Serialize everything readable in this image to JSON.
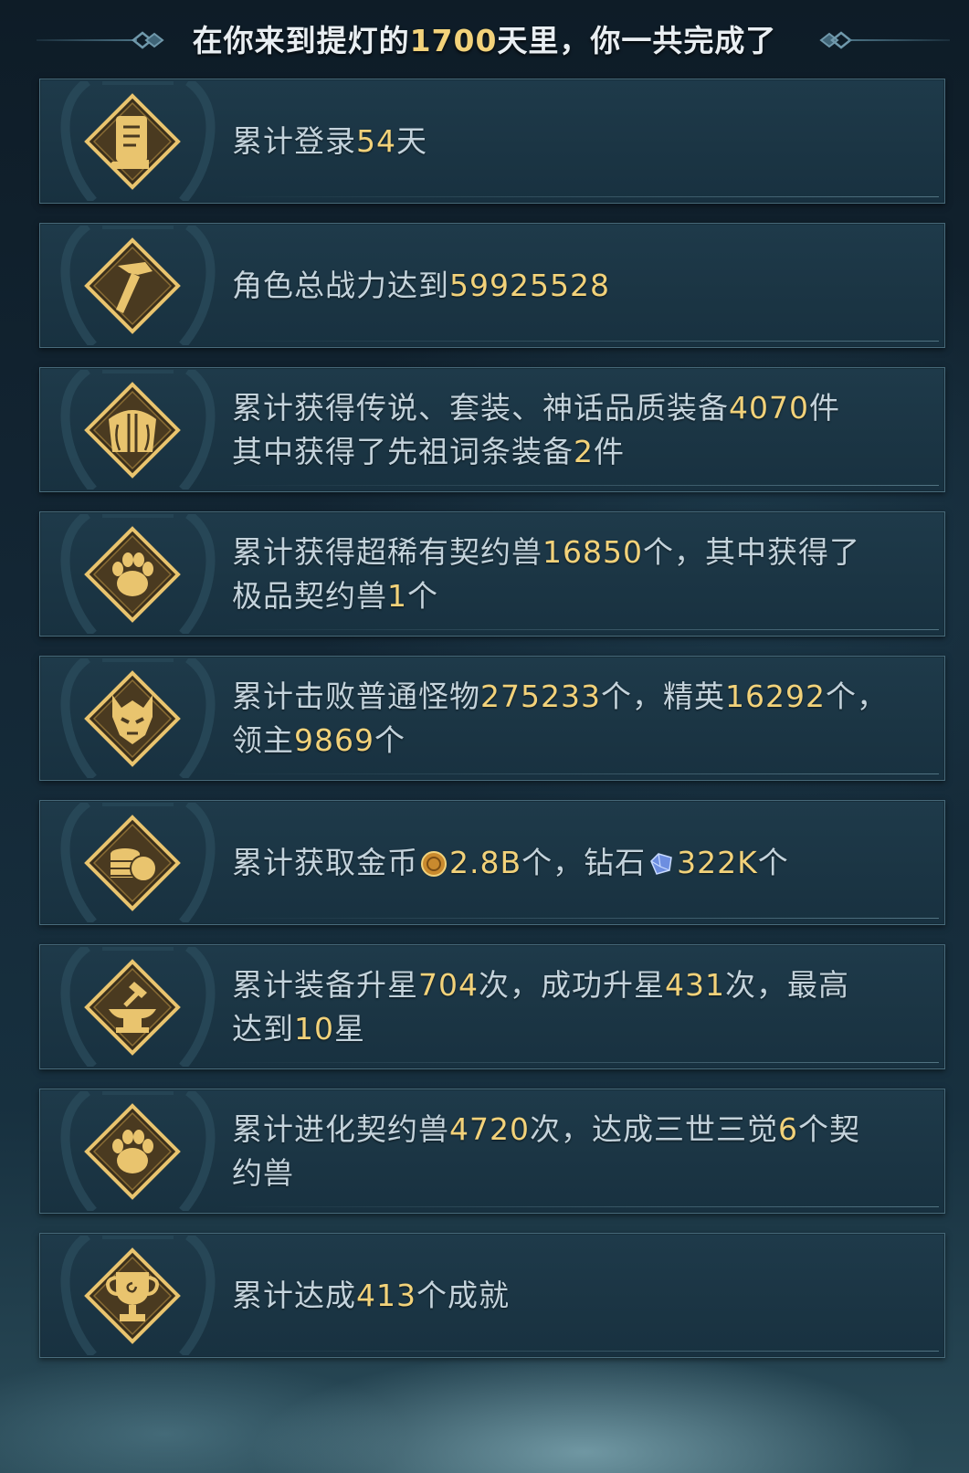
{
  "header": {
    "prefix": "在你来到提灯的",
    "days": "1700",
    "suffix": "天里，你一共完成了"
  },
  "cards": [
    {
      "icon": "scroll-icon",
      "parts": [
        {
          "t": "累计登录"
        },
        {
          "t": "54",
          "n": true
        },
        {
          "t": "天"
        }
      ]
    },
    {
      "icon": "hammer-icon",
      "parts": [
        {
          "t": "角色总战力达到"
        },
        {
          "t": "59925528",
          "n": true
        }
      ]
    },
    {
      "icon": "armor-icon",
      "parts": [
        {
          "t": "累计获得传说、套装、神话品质装备"
        },
        {
          "t": "4070",
          "n": true
        },
        {
          "t": "件"
        },
        {
          "br": true
        },
        {
          "t": "其中获得了先祖词条装备"
        },
        {
          "t": "2",
          "n": true
        },
        {
          "t": "件"
        }
      ]
    },
    {
      "icon": "paw-icon",
      "parts": [
        {
          "t": "累计获得超稀有契约兽"
        },
        {
          "t": "16850",
          "n": true
        },
        {
          "t": "个，其中获得了"
        },
        {
          "br": true
        },
        {
          "t": "极品契约兽"
        },
        {
          "t": "1",
          "n": true
        },
        {
          "t": "个"
        }
      ]
    },
    {
      "icon": "demon-skull-icon",
      "parts": [
        {
          "t": "累计击败普通怪物"
        },
        {
          "t": "275233",
          "n": true
        },
        {
          "t": "个，精英"
        },
        {
          "t": "16292",
          "n": true
        },
        {
          "t": "个，"
        },
        {
          "br": true
        },
        {
          "t": "领主"
        },
        {
          "t": "9869",
          "n": true
        },
        {
          "t": "个"
        }
      ]
    },
    {
      "icon": "coins-icon",
      "parts": [
        {
          "t": "累计获取金币"
        },
        {
          "img": "gold-coin-icon"
        },
        {
          "t": "2.8B",
          "n": true
        },
        {
          "t": "个，钻石"
        },
        {
          "img": "diamond-icon"
        },
        {
          "t": "322K",
          "n": true
        },
        {
          "t": "个"
        }
      ]
    },
    {
      "icon": "anvil-icon",
      "parts": [
        {
          "t": "累计装备升星"
        },
        {
          "t": "704",
          "n": true
        },
        {
          "t": "次，成功升星"
        },
        {
          "t": "431",
          "n": true
        },
        {
          "t": "次，最高"
        },
        {
          "br": true
        },
        {
          "t": "达到"
        },
        {
          "t": "10",
          "n": true
        },
        {
          "t": "星"
        }
      ]
    },
    {
      "icon": "paw-icon",
      "parts": [
        {
          "t": "累计进化契约兽"
        },
        {
          "t": "4720",
          "n": true
        },
        {
          "t": "次，达成三世三觉"
        },
        {
          "t": "6",
          "n": true
        },
        {
          "t": "个契"
        },
        {
          "br": true
        },
        {
          "t": "约兽"
        }
      ]
    },
    {
      "icon": "trophy-icon",
      "parts": [
        {
          "t": "累计达成"
        },
        {
          "t": "413",
          "n": true
        },
        {
          "t": "个成就"
        }
      ]
    }
  ],
  "colors": {
    "highlight": "#f2d27a",
    "text": "#c4d3dc",
    "icon_gold": "#e9c46e"
  }
}
